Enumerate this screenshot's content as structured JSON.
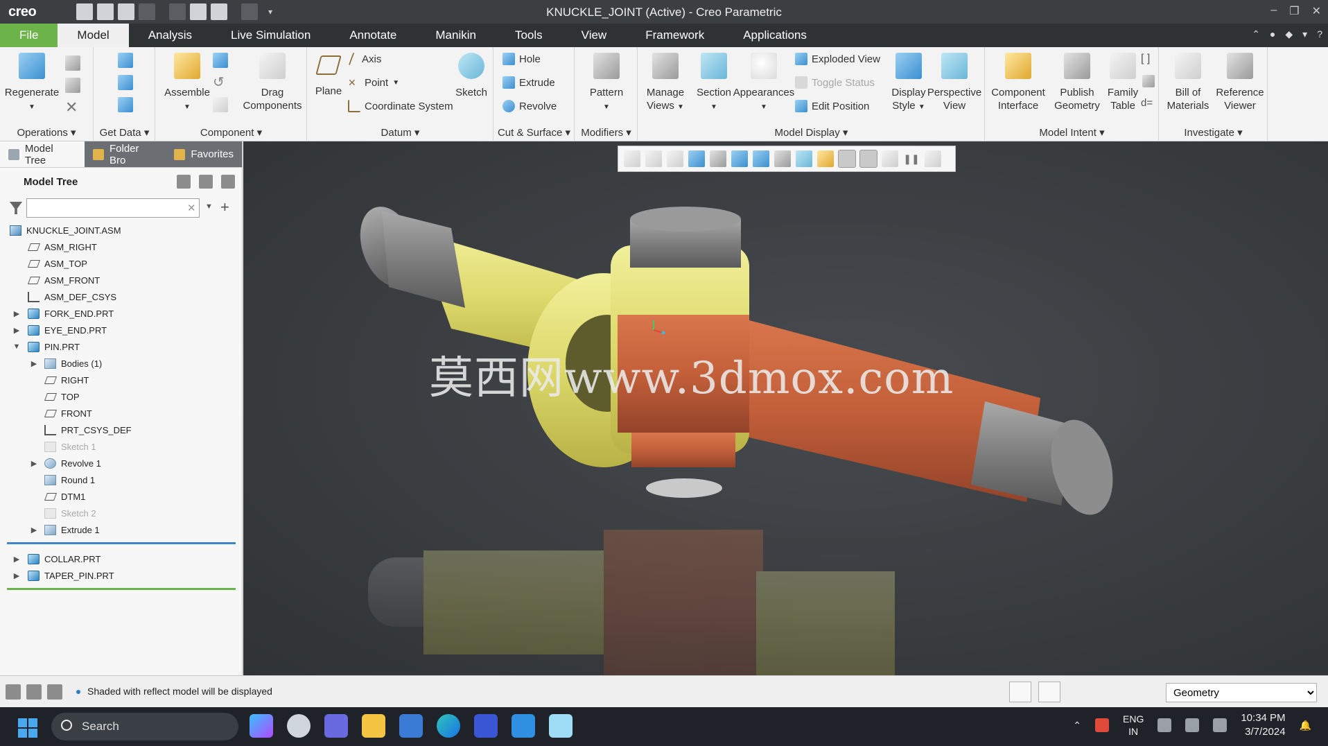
{
  "app": {
    "logo": "creo",
    "window_title": "KNUCKLE_JOINT (Active) - Creo Parametric"
  },
  "ribbon_tabs": [
    "File",
    "Model",
    "Analysis",
    "Live Simulation",
    "Annotate",
    "Manikin",
    "Tools",
    "View",
    "Framework",
    "Applications"
  ],
  "active_tab": "Model",
  "ribbon": {
    "operations": {
      "label": "Operations",
      "regenerate": "Regenerate"
    },
    "get_data": {
      "label": "Get Data"
    },
    "component": {
      "label": "Component",
      "assemble": "Assemble",
      "drag_components": "Drag Components"
    },
    "datum": {
      "label": "Datum",
      "plane": "Plane",
      "axis": "Axis",
      "point": "Point",
      "coordinate_system": "Coordinate System",
      "sketch": "Sketch"
    },
    "cut_surface": {
      "label": "Cut & Surface",
      "hole": "Hole",
      "extrude": "Extrude",
      "revolve": "Revolve"
    },
    "modifiers": {
      "label": "Modifiers",
      "pattern": "Pattern"
    },
    "model_display": {
      "label": "Model Display",
      "manage_views": "Manage Views",
      "section": "Section",
      "appearances": "Appearances",
      "exploded_view": "Exploded View",
      "toggle_status": "Toggle Status",
      "edit_position": "Edit Position",
      "display_style": "Display Style",
      "perspective_view": "Perspective View"
    },
    "model_intent": {
      "label": "Model Intent",
      "component_interface": "Component Interface",
      "publish_geometry": "Publish Geometry",
      "family_table": "Family Table"
    },
    "investigate": {
      "label": "Investigate",
      "bill_of_materials": "Bill of Materials",
      "reference_viewer": "Reference Viewer"
    }
  },
  "panel_tabs": [
    "Model Tree",
    "Folder Bro",
    "Favorites"
  ],
  "model_tree": {
    "header": "Model Tree",
    "filter_placeholder": "",
    "items": [
      {
        "label": "KNUCKLE_JOINT.ASM",
        "icon": "assembly-icon"
      },
      {
        "label": "ASM_RIGHT",
        "icon": "datum-plane-icon"
      },
      {
        "label": "ASM_TOP",
        "icon": "datum-plane-icon"
      },
      {
        "label": "ASM_FRONT",
        "icon": "datum-plane-icon"
      },
      {
        "label": "ASM_DEF_CSYS",
        "icon": "csys-icon"
      },
      {
        "label": "FORK_END.PRT",
        "icon": "part-icon"
      },
      {
        "label": "EYE_END.PRT",
        "icon": "part-icon"
      },
      {
        "label": "PIN.PRT",
        "icon": "part-icon"
      },
      {
        "label": "Bodies (1)",
        "icon": "bodies-icon"
      },
      {
        "label": "RIGHT",
        "icon": "datum-plane-icon"
      },
      {
        "label": "TOP",
        "icon": "datum-plane-icon"
      },
      {
        "label": "FRONT",
        "icon": "datum-plane-icon"
      },
      {
        "label": "PRT_CSYS_DEF",
        "icon": "csys-icon"
      },
      {
        "label": "Sketch 1",
        "icon": "sketch-icon"
      },
      {
        "label": "Revolve 1",
        "icon": "revolve-icon"
      },
      {
        "label": "Round 1",
        "icon": "round-icon"
      },
      {
        "label": "DTM1",
        "icon": "datum-plane-icon"
      },
      {
        "label": "Sketch 2",
        "icon": "sketch-icon"
      },
      {
        "label": "Extrude 1",
        "icon": "extrude-icon"
      },
      {
        "label": "COLLAR.PRT",
        "icon": "part-icon"
      },
      {
        "label": "TAPER_PIN.PRT",
        "icon": "part-icon"
      }
    ]
  },
  "viewport": {
    "watermark": "莫西网www.3dmox.com"
  },
  "status": {
    "message": "Shaded with reflect model will be displayed",
    "filter_value": "Geometry"
  },
  "taskbar": {
    "search": "Search",
    "lang_line1": "ENG",
    "lang_line2": "IN",
    "time": "10:34 PM",
    "date": "3/7/2024"
  }
}
